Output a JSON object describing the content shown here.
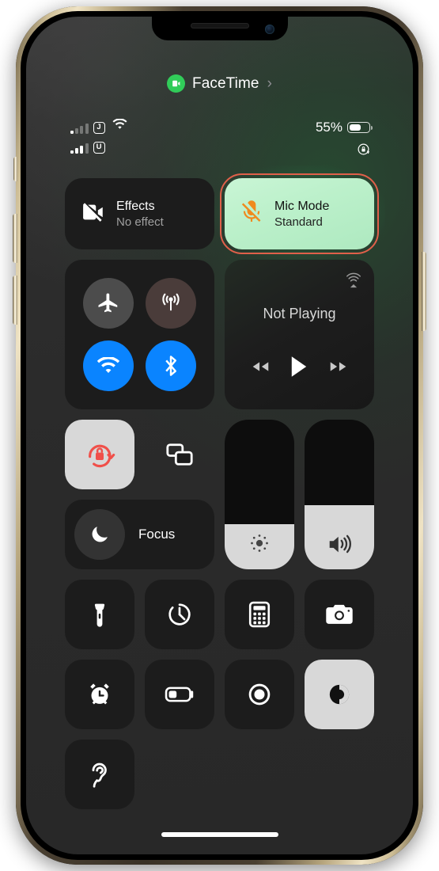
{
  "header": {
    "app_pill": {
      "label": "FaceTime",
      "icon": "video-camera-icon",
      "chevron": "›",
      "badge_color": "#31cc59"
    }
  },
  "status_bar": {
    "sim1": {
      "tag": "J",
      "bars_active": 1,
      "bars_total": 4
    },
    "sim2": {
      "tag": "U",
      "bars_active": 3,
      "bars_total": 4
    },
    "wifi_icon": "wifi-icon",
    "battery_percent": "55%",
    "battery_level": 55,
    "rotation_lock_icon": "rotation-lock-icon"
  },
  "control_center": {
    "effects": {
      "title": "Effects",
      "subtitle": "No effect",
      "icon": "video-off-icon",
      "active": false
    },
    "mic_mode": {
      "title": "Mic Mode",
      "subtitle": "Standard",
      "icon": "mic-muted-icon",
      "active": true,
      "tile_color": "#bbf0ca",
      "icon_color": "#f08a1e",
      "highlight_color": "#e0604a",
      "glow_color": "#40be6e"
    },
    "connectivity": [
      {
        "name": "airplane-mode",
        "icon": "airplane-icon",
        "on": false,
        "bg": "#4c4c4c"
      },
      {
        "name": "cellular-data",
        "icon": "cellular-antenna-icon",
        "on": false,
        "bg": "#4a3c3a"
      },
      {
        "name": "wifi",
        "icon": "wifi-icon",
        "on": true,
        "bg": "#0a84ff"
      },
      {
        "name": "bluetooth",
        "icon": "bluetooth-icon",
        "on": true,
        "bg": "#0a84ff"
      }
    ],
    "media": {
      "title": "Not Playing",
      "airplay_icon": "airplay-icon",
      "rewind_icon": "rewind-icon",
      "play_icon": "play-icon",
      "forward_icon": "fast-forward-icon"
    },
    "rotation_lock": {
      "name": "rotation-lock",
      "icon": "rotation-lock-icon",
      "on": true,
      "icon_color": "#f0504a"
    },
    "screen_mirroring": {
      "name": "screen-mirroring",
      "icon": "screen-mirroring-icon",
      "on": false
    },
    "focus": {
      "label": "Focus",
      "icon": "moon-icon",
      "on": false
    },
    "brightness": {
      "name": "brightness-slider",
      "icon": "brightness-icon",
      "value": 30
    },
    "volume": {
      "name": "volume-slider",
      "icon": "speaker-icon",
      "value": 43
    },
    "shortcuts_row_1": [
      {
        "name": "flashlight",
        "icon": "flashlight-icon",
        "on": false
      },
      {
        "name": "timer",
        "icon": "timer-icon",
        "on": false
      },
      {
        "name": "calculator",
        "icon": "calculator-icon",
        "on": false
      },
      {
        "name": "camera",
        "icon": "camera-icon",
        "on": false
      }
    ],
    "shortcuts_row_2": [
      {
        "name": "alarm",
        "icon": "alarm-clock-icon",
        "on": false
      },
      {
        "name": "low-power-mode",
        "icon": "battery-icon",
        "on": false
      },
      {
        "name": "screen-recording",
        "icon": "record-icon",
        "on": false
      },
      {
        "name": "dark-mode",
        "icon": "dark-mode-icon",
        "on": true
      }
    ],
    "shortcuts_row_3": [
      {
        "name": "hearing",
        "icon": "ear-icon",
        "on": false
      }
    ]
  },
  "home_indicator": {
    "name": "home-indicator"
  }
}
